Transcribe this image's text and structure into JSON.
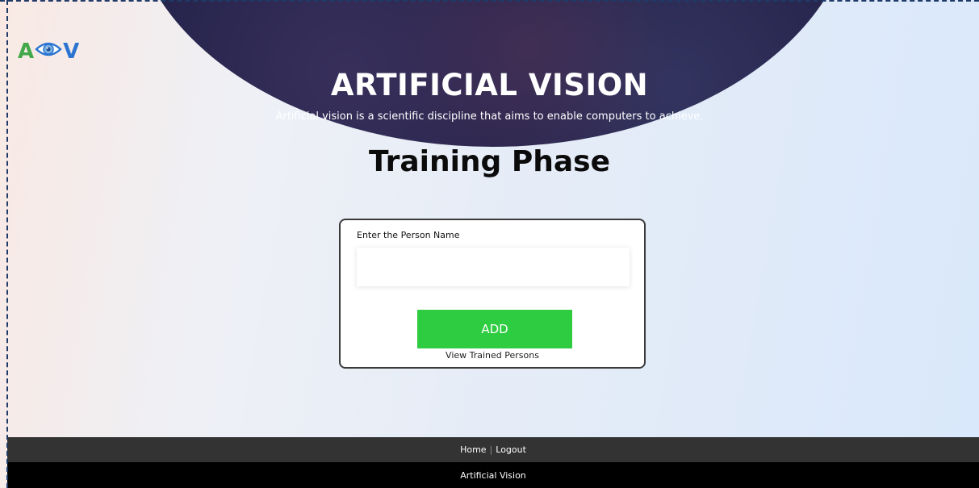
{
  "logo": {
    "letter_left": "A",
    "letter_right": "V",
    "icon": "eye-icon",
    "colors": {
      "left": "#43a84a",
      "right": "#2b74d1",
      "eye": "#2b74d1"
    }
  },
  "hero": {
    "title": "ARTIFICIAL VISION",
    "subtitle": "Artificial vision is a scientific discipline that aims to enable computers to achieve.",
    "background": "#26244c"
  },
  "page_title": "Training Phase",
  "form": {
    "name_label": "Enter the Person Name",
    "name_value": "",
    "name_placeholder": "",
    "add_button_label": "ADD",
    "add_button_color": "#2ecc40",
    "view_link_label": "View Trained Persons"
  },
  "footer": {
    "nav": {
      "home_label": "Home",
      "separator": "|",
      "logout_label": "Logout"
    },
    "copyright_label": "Artificial Vision"
  }
}
